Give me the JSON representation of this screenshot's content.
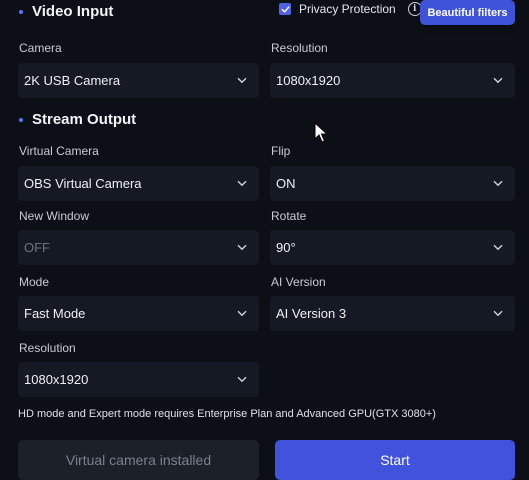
{
  "video_input": {
    "title": "Video Input",
    "privacy_label": "Privacy Protection",
    "privacy_checked": true,
    "beautiful_filters_label": "Beautiful filters",
    "camera_label": "Camera",
    "camera_value": "2K USB Camera",
    "resolution_label": "Resolution",
    "resolution_value": "1080x1920"
  },
  "stream_output": {
    "title": "Stream Output",
    "virtual_camera_label": "Virtual Camera",
    "virtual_camera_value": "OBS Virtual Camera",
    "flip_label": "Flip",
    "flip_value": "ON",
    "new_window_label": "New Window",
    "new_window_value": "OFF",
    "rotate_label": "Rotate",
    "rotate_value": "90°",
    "mode_label": "Mode",
    "mode_value": "Fast Mode",
    "ai_version_label": "AI Version",
    "ai_version_value": "AI Version 3",
    "resolution_label": "Resolution",
    "resolution_value": "1080x1920"
  },
  "note": "HD mode and Expert mode requires Enterprise Plan and Advanced GPU(GTX 3080+)",
  "actions": {
    "virtual_camera_installed_label": "Virtual camera installed",
    "start_label": "Start"
  },
  "colors": {
    "background": "#0c0f16",
    "select_bg": "#151924",
    "accent": "#4153dc",
    "bullet": "#5a73ff"
  },
  "icons": {
    "chevron": "chevron-down-icon",
    "info": "info-icon",
    "check": "check-icon",
    "cursor": "mouse-cursor-icon"
  }
}
